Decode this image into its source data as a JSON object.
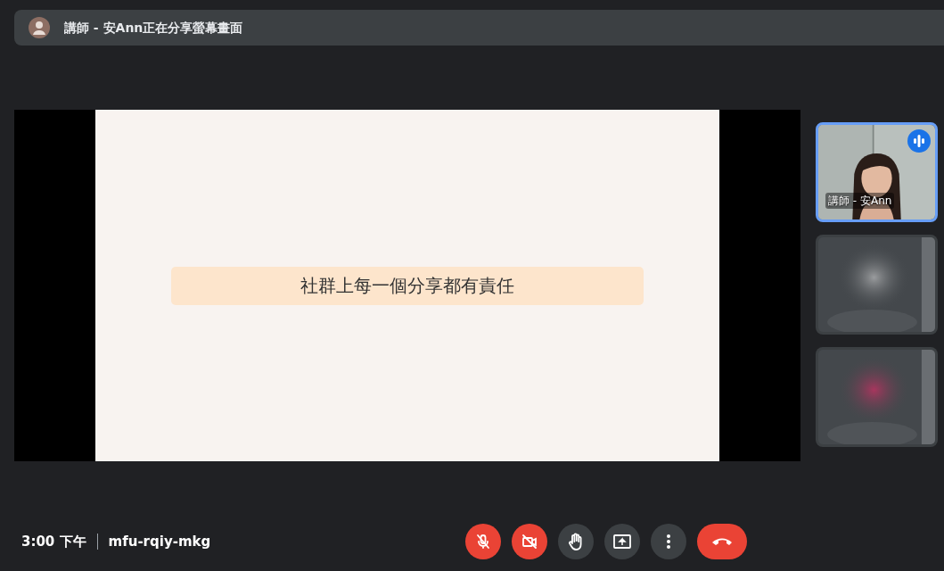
{
  "presenter_banner": {
    "text": "講師 - 安Ann正在分享螢幕畫面"
  },
  "shared_slide": {
    "text": "社群上每一個分享都有責任"
  },
  "tiles": [
    {
      "kind": "camera",
      "label": "講師 - 安Ann",
      "speaking": true
    },
    {
      "kind": "blurred",
      "speaking": false
    },
    {
      "kind": "blurred",
      "speaking": false
    }
  ],
  "footer": {
    "time": "3:00 下午",
    "meeting_code": "mfu-rqiy-mkg"
  },
  "controls": [
    {
      "kind": "mic",
      "off": true
    },
    {
      "kind": "camera",
      "off": true
    },
    {
      "kind": "hand",
      "off": false
    },
    {
      "kind": "present",
      "off": false
    },
    {
      "kind": "more",
      "off": false
    },
    {
      "kind": "hangup"
    }
  ]
}
